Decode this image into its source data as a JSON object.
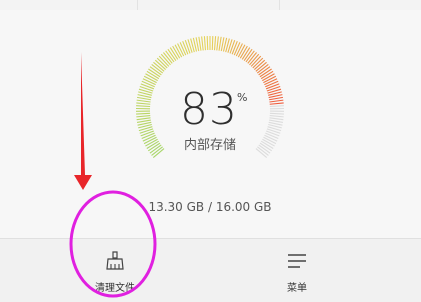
{
  "storage": {
    "percent": "83",
    "percent_unit": "%",
    "label": "内部存储",
    "capacity": "13.30 GB / 16.00 GB",
    "used_fraction": 0.83
  },
  "tabs": [
    {
      "label": "清理文件",
      "icon": "broom-icon"
    },
    {
      "label": "菜单",
      "icon": "menu-icon"
    }
  ],
  "annotation": {
    "arrow_color": "#e8262a",
    "circle_color": "#e020e0"
  },
  "colors": {
    "gauge_start": "#a8d66a",
    "gauge_mid": "#e6d35a",
    "gauge_end": "#ef5a3c",
    "gauge_track": "#dcdcdc"
  }
}
